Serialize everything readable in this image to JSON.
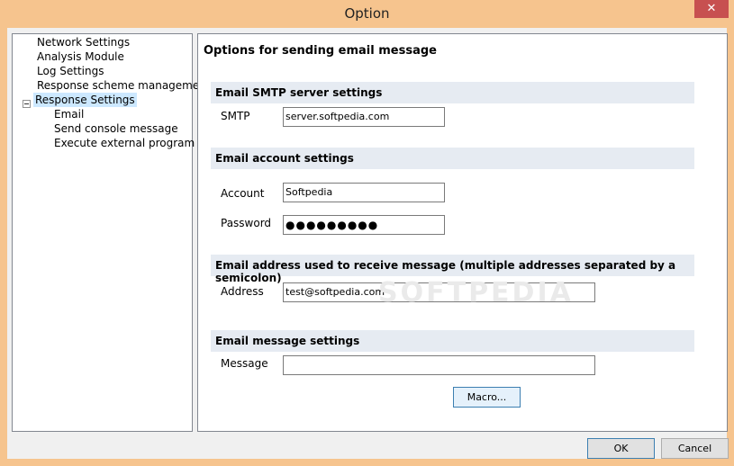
{
  "window": {
    "title": "Option",
    "close_icon": "close-icon",
    "close_glyph": "✕"
  },
  "tree": {
    "items": [
      {
        "label": "Network Settings"
      },
      {
        "label": "Analysis Module"
      },
      {
        "label": "Log Settings"
      },
      {
        "label": "Response scheme management"
      },
      {
        "label": "Response Settings",
        "selected": true,
        "expanded": true
      },
      {
        "label": "Email"
      },
      {
        "label": "Send console message"
      },
      {
        "label": "Execute external program"
      }
    ]
  },
  "panel": {
    "heading": "Options for sending email message",
    "sections": {
      "smtp": "Email SMTP server settings",
      "account": "Email account settings",
      "address": "Email address  used to receive message (multiple addresses separated by a semicolon)",
      "message": "Email message settings"
    },
    "fields": {
      "smtp": {
        "label": "SMTP",
        "value": "server.softpedia.com"
      },
      "account": {
        "label": "Account",
        "value": "Softpedia"
      },
      "password": {
        "label": "Password",
        "value": "●●●●●●●●●"
      },
      "address": {
        "label": "Address",
        "value": "test@softpedia.com"
      },
      "message": {
        "label": "Message",
        "value": ""
      }
    },
    "macro_label": "Macro..."
  },
  "buttons": {
    "ok": "OK",
    "cancel": "Cancel"
  },
  "watermark": "SOFTPEDIA",
  "colors": {
    "titlebar": "#f6c48e",
    "close": "#c75050",
    "selection": "#cce8ff",
    "section_bg": "#e6ebf2"
  }
}
